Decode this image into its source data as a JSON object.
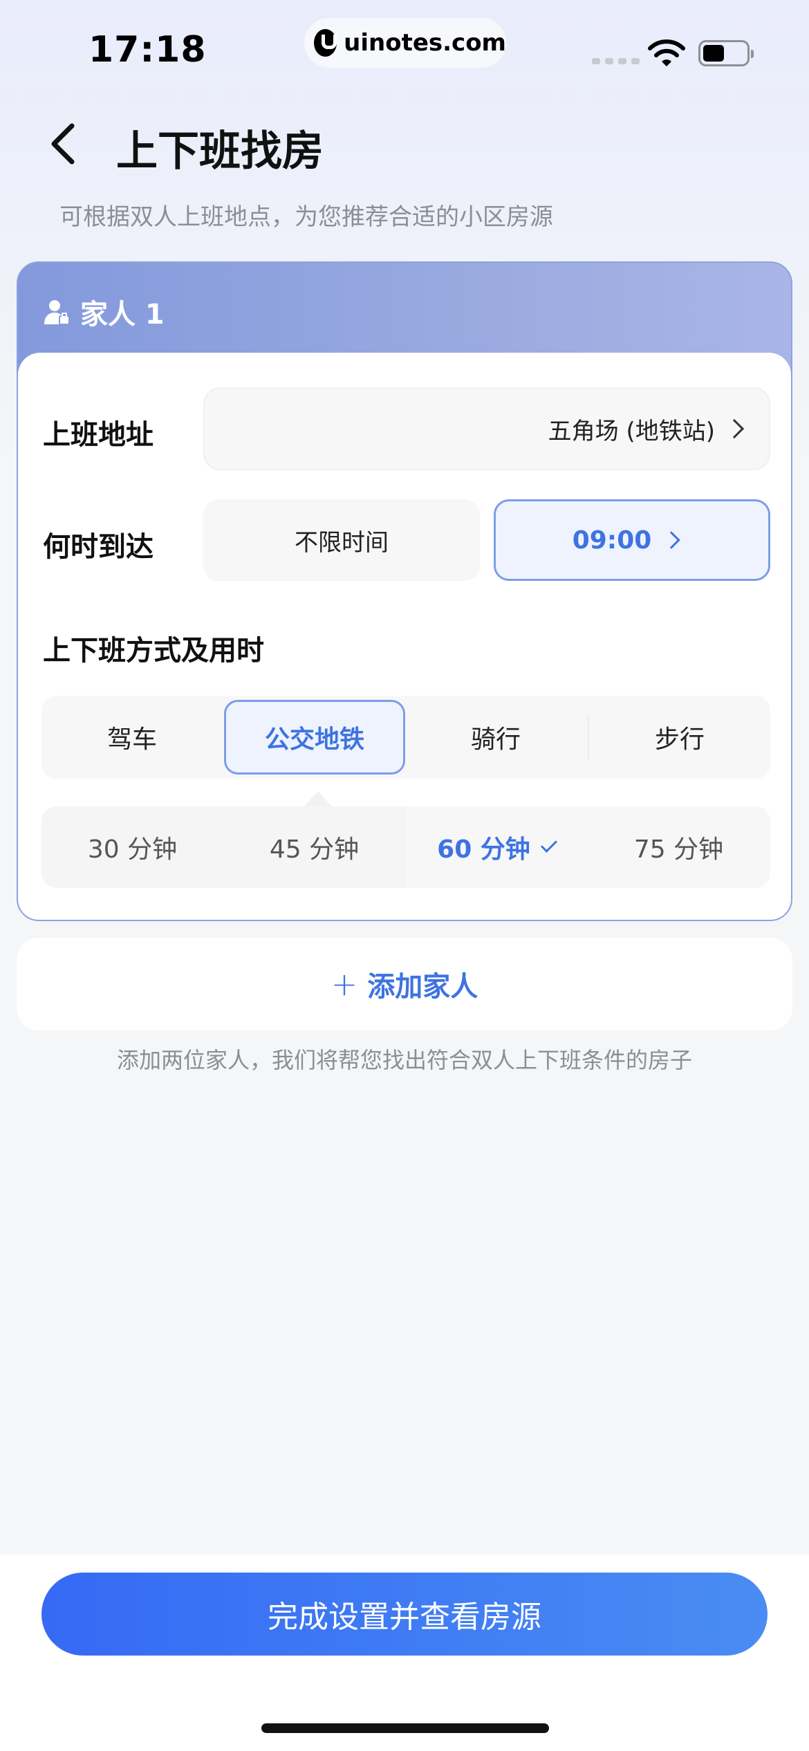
{
  "status_bar": {
    "time": "17:18",
    "watermark": "uinotes.com"
  },
  "header": {
    "title": "上下班找房",
    "subtitle": "可根据双人上班地点，为您推荐合适的小区房源"
  },
  "family_card": {
    "title": "家人 1",
    "address_label": "上班地址",
    "address_value": "五角场 (地铁站)",
    "arrival_label": "何时到达",
    "arrival_options": [
      "不限时间",
      "09:00"
    ],
    "arrival_selected": "09:00",
    "commute_title": "上下班方式及用时",
    "modes": [
      "驾车",
      "公交地铁",
      "骑行",
      "步行"
    ],
    "mode_selected": "公交地铁",
    "durations": [
      "30 分钟",
      "45 分钟",
      "60 分钟",
      "75 分钟"
    ],
    "duration_selected": "60 分钟"
  },
  "add_family": {
    "plus": "+",
    "label": "添加家人",
    "hint": "添加两位家人，我们将帮您找出符合双人上下班条件的房子"
  },
  "footer": {
    "submit_label": "完成设置并查看房源"
  },
  "colors": {
    "accent": "#3e73e2",
    "button_start": "#356af5",
    "button_end": "#4a8cf3",
    "card_header": "#8399dc"
  }
}
